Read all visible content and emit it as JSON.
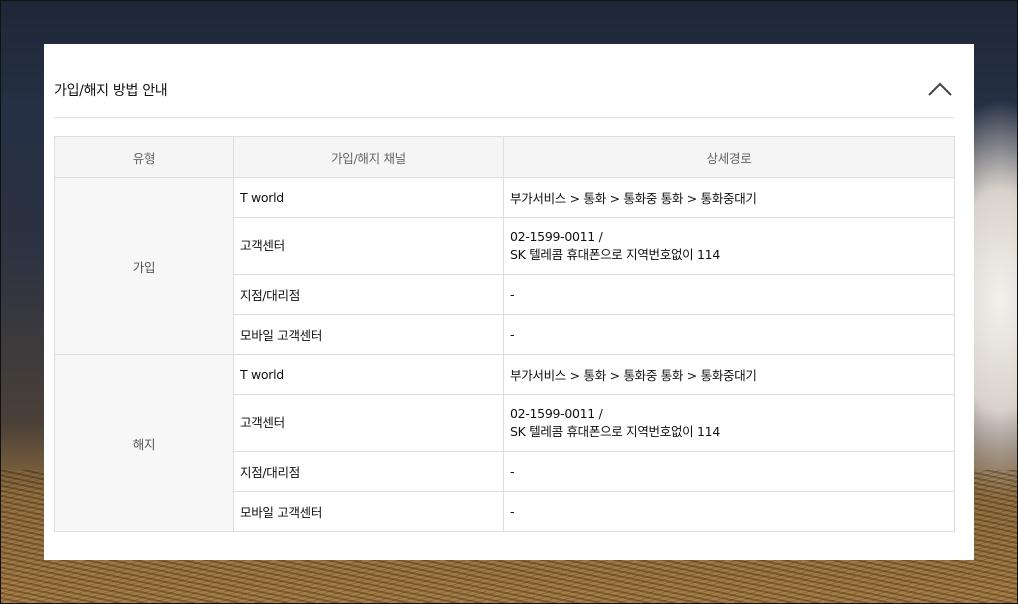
{
  "section": {
    "title": "가입/해지 방법 안내",
    "collapse_icon": "chevron-up-icon"
  },
  "table": {
    "headers": {
      "type": "유형",
      "channel": "가입/해지 채널",
      "detail": "상세경로"
    },
    "groups": [
      {
        "type": "가입",
        "rows": [
          {
            "channel": "T world",
            "detail": [
              "부가서비스 > 통화 > 통화중 통화 > 통화중대기"
            ]
          },
          {
            "channel": "고객센터",
            "detail": [
              "02-1599-0011 /",
              "SK 텔레콤 휴대폰으로 지역번호없이 114"
            ]
          },
          {
            "channel": "지점/대리점",
            "detail": [
              "-"
            ]
          },
          {
            "channel": "모바일 고객센터",
            "detail": [
              "-"
            ]
          }
        ]
      },
      {
        "type": "해지",
        "rows": [
          {
            "channel": "T world",
            "detail": [
              "부가서비스 > 통화 > 통화중 통화 > 통화중대기"
            ]
          },
          {
            "channel": "고객센터",
            "detail": [
              "02-1599-0011 /",
              "SK 텔레콤 휴대폰으로 지역번호없이 114"
            ]
          },
          {
            "channel": "지점/대리점",
            "detail": [
              "-"
            ]
          },
          {
            "channel": "모바일 고객센터",
            "detail": [
              "-"
            ]
          }
        ]
      }
    ]
  },
  "colors": {
    "panel_background": "#ffffff",
    "header_cell_background": "#f5f5f5",
    "type_cell_background": "#f7f7f7",
    "border": "#dedede"
  }
}
